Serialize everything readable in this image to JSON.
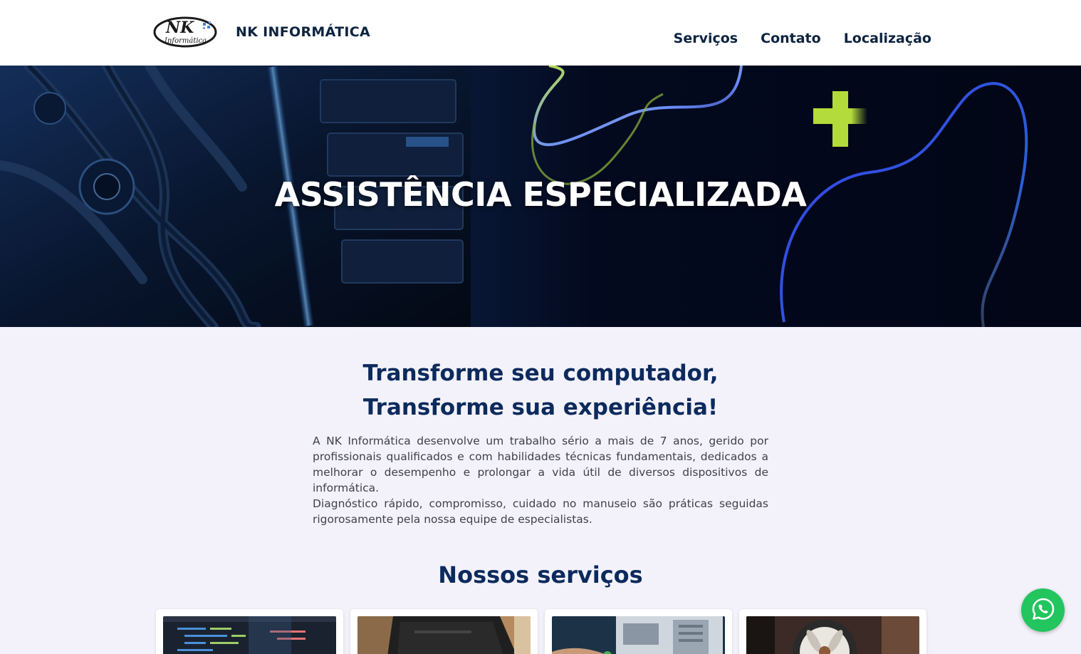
{
  "header": {
    "logo_text": "NK",
    "logo_subtext": "Informática",
    "brand": "NK INFORMÁTICA",
    "nav": [
      "Serviços",
      "Contato",
      "Localização"
    ]
  },
  "hero": {
    "title": "ASSISTÊNCIA ESPECIALIZADA"
  },
  "intro": {
    "heading_line1": "Transforme seu computador,",
    "heading_line2": "Transforme sua experiência!",
    "paragraph1": "A NK Informática desenvolve um trabalho sério a mais de 7 anos, gerido por profissionais qualificados e com habilidades técnicas fundamentais, dedicados a melhorar o desempenho e prolongar a vida útil de diversos dispositivos de informática.",
    "paragraph2": "Diagnóstico rápido, compromisso, cuidado no manuseio são práticas seguidas rigorosamente pela nossa equipe de especialistas."
  },
  "services": {
    "title": "Nossos serviços",
    "cards": [
      {
        "image": "code-monitor-photo"
      },
      {
        "image": "computer-case-photo"
      },
      {
        "image": "pc-repair-photo"
      },
      {
        "image": "fan-cleaning-photo"
      }
    ]
  },
  "floating": {
    "whatsapp_icon": "whatsapp-icon"
  },
  "colors": {
    "primary": "#0c2a5c",
    "nav_text": "#0c2340",
    "body_text": "#3f4247",
    "background": "#f3f2fb",
    "whatsapp": "#22c55e",
    "accent_green": "#a3d13f"
  }
}
